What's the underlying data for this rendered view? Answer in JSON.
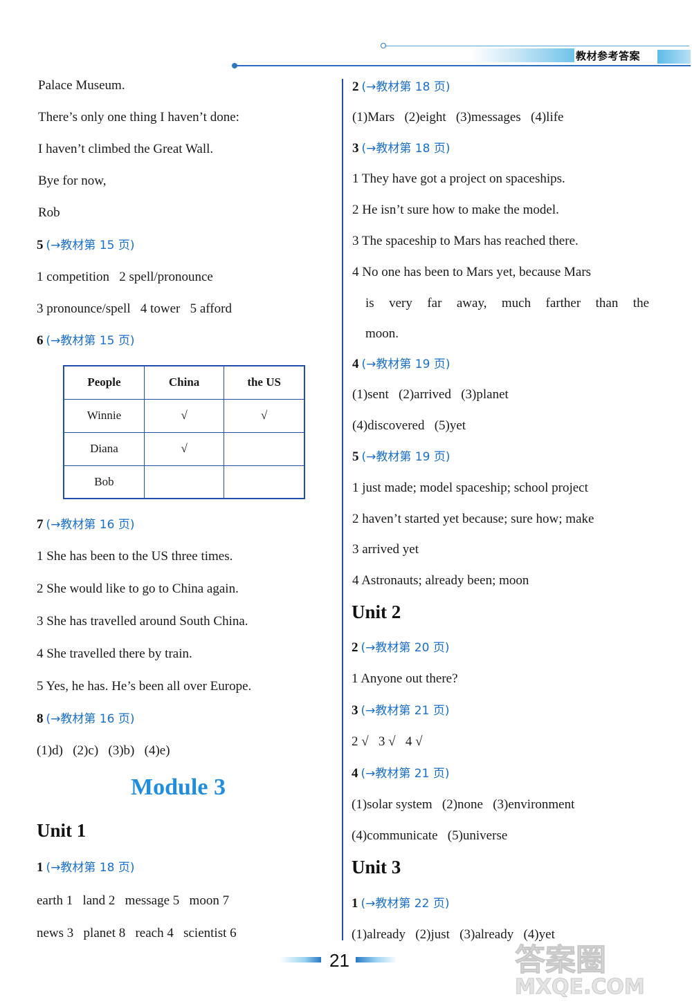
{
  "header": {
    "section_title": "教材参考答案"
  },
  "left_column": {
    "intro_lines": [
      "Palace Museum.",
      "There’s only one thing I haven’t done:",
      "I haven’t climbed the Great Wall.",
      "Bye for now,",
      "Rob"
    ],
    "q5": {
      "num": "5",
      "ref": "(→教材第 15 页)",
      "lines": [
        "1 competition   2 spell/pronounce",
        "3 pronounce/spell   4 tower   5 afford"
      ]
    },
    "q6": {
      "num": "6",
      "ref": "(→教材第 15 页)",
      "table": {
        "headers": [
          "People",
          "China",
          "the US"
        ],
        "rows": [
          [
            "Winnie",
            "√",
            "√"
          ],
          [
            "Diana",
            "√",
            ""
          ],
          [
            "Bob",
            "",
            ""
          ]
        ]
      }
    },
    "q7": {
      "num": "7",
      "ref": "(→教材第 16 页)",
      "lines": [
        "1 She has been to the US three times.",
        "2 She would like to go to China again.",
        "3 She has travelled around South China.",
        "4 She travelled there by train.",
        "5 Yes, he has. He’s been all over Europe."
      ]
    },
    "q8": {
      "num": "8",
      "ref": "(→教材第 16 页)",
      "line": "(1)d)   (2)c)   (3)b)   (4)e)"
    },
    "module_title": "Module 3",
    "unit1": {
      "title": "Unit 1",
      "q1": {
        "num": "1",
        "ref": "(→教材第 18 页)",
        "lines": [
          "earth 1   land 2   message 5   moon 7",
          "news 3   planet 8   reach 4   scientist 6"
        ]
      }
    }
  },
  "right_column": {
    "q2": {
      "num": "2",
      "ref": "(→教材第 18 页)",
      "line": "(1)Mars   (2)eight   (3)messages   (4)life"
    },
    "q3": {
      "num": "3",
      "ref": "(→教材第 18 页)",
      "lines": [
        "1 They have got a project on spaceships.",
        "2 He isn’t sure how to make the model.",
        "3 The spaceship to Mars has reached there.",
        "4 No one has been to Mars yet, because Mars",
        "is very far away, much farther than the",
        "moon."
      ]
    },
    "q4": {
      "num": "4",
      "ref": "(→教材第 19 页)",
      "lines": [
        "(1)sent   (2)arrived   (3)planet",
        "(4)discovered   (5)yet"
      ]
    },
    "q5": {
      "num": "5",
      "ref": "(→教材第 19 页)",
      "lines": [
        "1 just made; model spaceship; school project",
        "2 haven’t started yet because; sure how; make",
        "3 arrived yet",
        "4 Astronauts; already been; moon"
      ]
    },
    "unit2": {
      "title": "Unit 2",
      "q2": {
        "num": "2",
        "ref": "(→教材第 20 页)",
        "line": "1 Anyone out there?"
      },
      "q3": {
        "num": "3",
        "ref": "(→教材第 21 页)",
        "line": "2 √   3 √   4 √"
      },
      "q4": {
        "num": "4",
        "ref": "(→教材第 21 页)",
        "lines": [
          "(1)solar system   (2)none   (3)environment",
          "(4)communicate   (5)universe"
        ]
      }
    },
    "unit3": {
      "title": "Unit 3",
      "q1": {
        "num": "1",
        "ref": "(→教材第 22 页)",
        "line": "(1)already   (2)just   (3)already   (4)yet"
      }
    }
  },
  "footer": {
    "page_number": "21",
    "watermark_line1": "答案圈",
    "watermark_line2": "MXQE.COM"
  }
}
